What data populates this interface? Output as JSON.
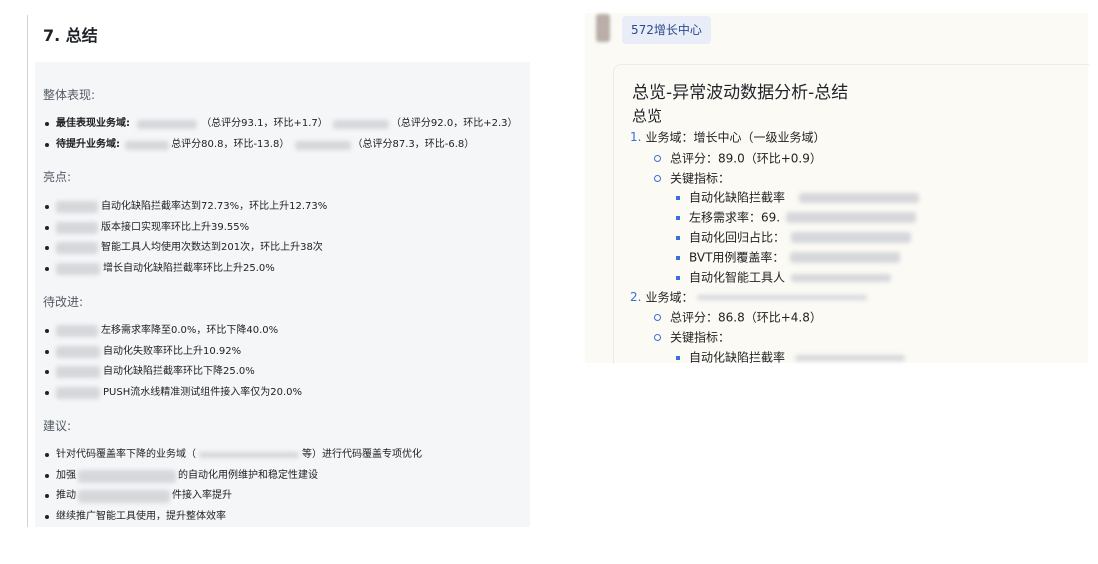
{
  "left": {
    "title": "7. 总结",
    "overall": {
      "heading": "整体表现:",
      "best": {
        "label": "最佳表现业务域:",
        "text1": "（总评分93.1，环比+1.7）",
        "text2": "（总评分92.0，环比+2.3）"
      },
      "improve": {
        "label": "待提升业务域:",
        "text1": "总评分80.8，环比-13.8）",
        "text2": "（总评分87.3，环比-6.8）"
      }
    },
    "highlights": {
      "heading": "亮点:",
      "items": [
        "自动化缺陷拦截率达到72.73%，环比上升12.73%",
        "版本接口实现率环比上升39.55%",
        "智能工具人均使用次数达到201次，环比上升38次",
        "增长自动化缺陷拦截率环比上升25.0%"
      ]
    },
    "todo": {
      "heading": "待改进:",
      "items": [
        "左移需求率降至0.0%，环比下降40.0%",
        "自动化失败率环比上升10.92%",
        "自动化缺陷拦截率环比下降25.0%",
        "PUSH流水线精准测试组件接入率仅为20.0%"
      ]
    },
    "advice": {
      "heading": "建议:",
      "items": [
        {
          "pre": "针对代码覆盖率下降的业务域（",
          "post": "等）进行代码覆盖专项优化"
        },
        {
          "pre": "加强",
          "post": "的自动化用例维护和稳定性建设"
        },
        {
          "pre": "推动",
          "post": "件接入率提升"
        },
        {
          "pre": "继续推广智能工具使用，提升整体效率",
          "post": ""
        }
      ]
    }
  },
  "right": {
    "tag": "572增长中心",
    "title": "总览-异常波动数据分析-总结",
    "subtitle": "总览",
    "domain1": {
      "num": "1.",
      "text": "业务域：增长中心（一级业务域）"
    },
    "score1": "总评分：89.0（环比+0.9）",
    "metrics_label": "关键指标：",
    "metrics1": [
      "自动化缺陷拦截率",
      "左移需求率：69.",
      "自动化回归占比：",
      "BVT用例覆盖率：",
      "自动化智能工具人"
    ],
    "domain2": {
      "num": "2.",
      "text": "业务域："
    },
    "score2": "总评分：86.8（环比+4.8）",
    "metrics2": [
      "自动化缺陷拦截率"
    ]
  },
  "colors": {
    "accent": "#3a6fd8",
    "tag_bg": "#e8edf7",
    "tag_text": "#2c4a8f",
    "panel_bg": "#f5f6f8"
  }
}
